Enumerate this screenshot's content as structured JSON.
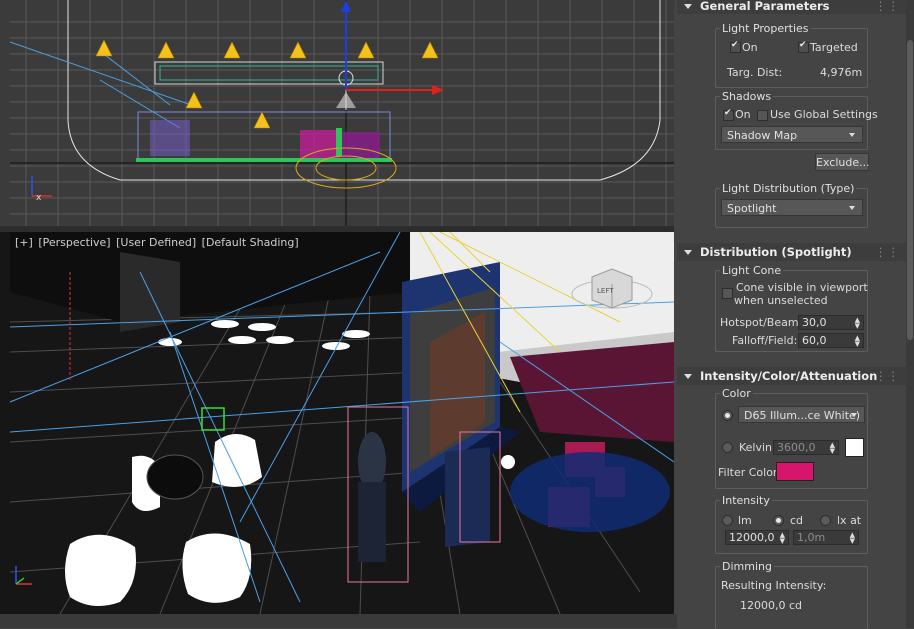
{
  "viewport": {
    "perspective_label": [
      "[+]",
      "[Perspective]",
      "[User Defined]",
      "[Default Shading]"
    ],
    "viewcube_face": "LEFT"
  },
  "panel": {
    "general": {
      "header": "General Parameters",
      "light_properties": {
        "title": "Light Properties",
        "on_label": "On",
        "on_checked": true,
        "targeted_label": "Targeted",
        "targeted_checked": true,
        "targ_dist_label": "Targ. Dist:",
        "targ_dist_value": "4,976m"
      },
      "shadows": {
        "title": "Shadows",
        "on_label": "On",
        "on_checked": true,
        "global_label": "Use Global Settings",
        "global_checked": false,
        "type": "Shadow Map",
        "exclude_label": "Exclude..."
      },
      "distribution": {
        "title": "Light Distribution (Type)",
        "type": "Spotlight"
      }
    },
    "spotlight": {
      "header": "Distribution (Spotlight)",
      "cone_title": "Light Cone",
      "cone_visible_label_1": "Cone visible in viewport",
      "cone_visible_label_2": "when unselected",
      "cone_visible_checked": false,
      "hotspot_label": "Hotspot/Beam:",
      "hotspot_value": "30,0",
      "falloff_label": "Falloff/Field:",
      "falloff_value": "60,0"
    },
    "intensity": {
      "header": "Intensity/Color/Attenuation",
      "color_title": "Color",
      "preset": "D65 Illum...ce White)",
      "kelvin_label": "Kelvin:",
      "kelvin_value": "3600,0",
      "filter_label": "Filter Color:",
      "filter_color": "#d8156c",
      "intensity_title": "Intensity",
      "unit_lm": "lm",
      "unit_cd": "cd",
      "unit_lx": "lx at",
      "intensity_value": "12000,0",
      "lx_distance": "1,0m",
      "dimming_title": "Dimming",
      "resulting_label": "Resulting Intensity:",
      "resulting_value": "12000,0 cd"
    }
  }
}
